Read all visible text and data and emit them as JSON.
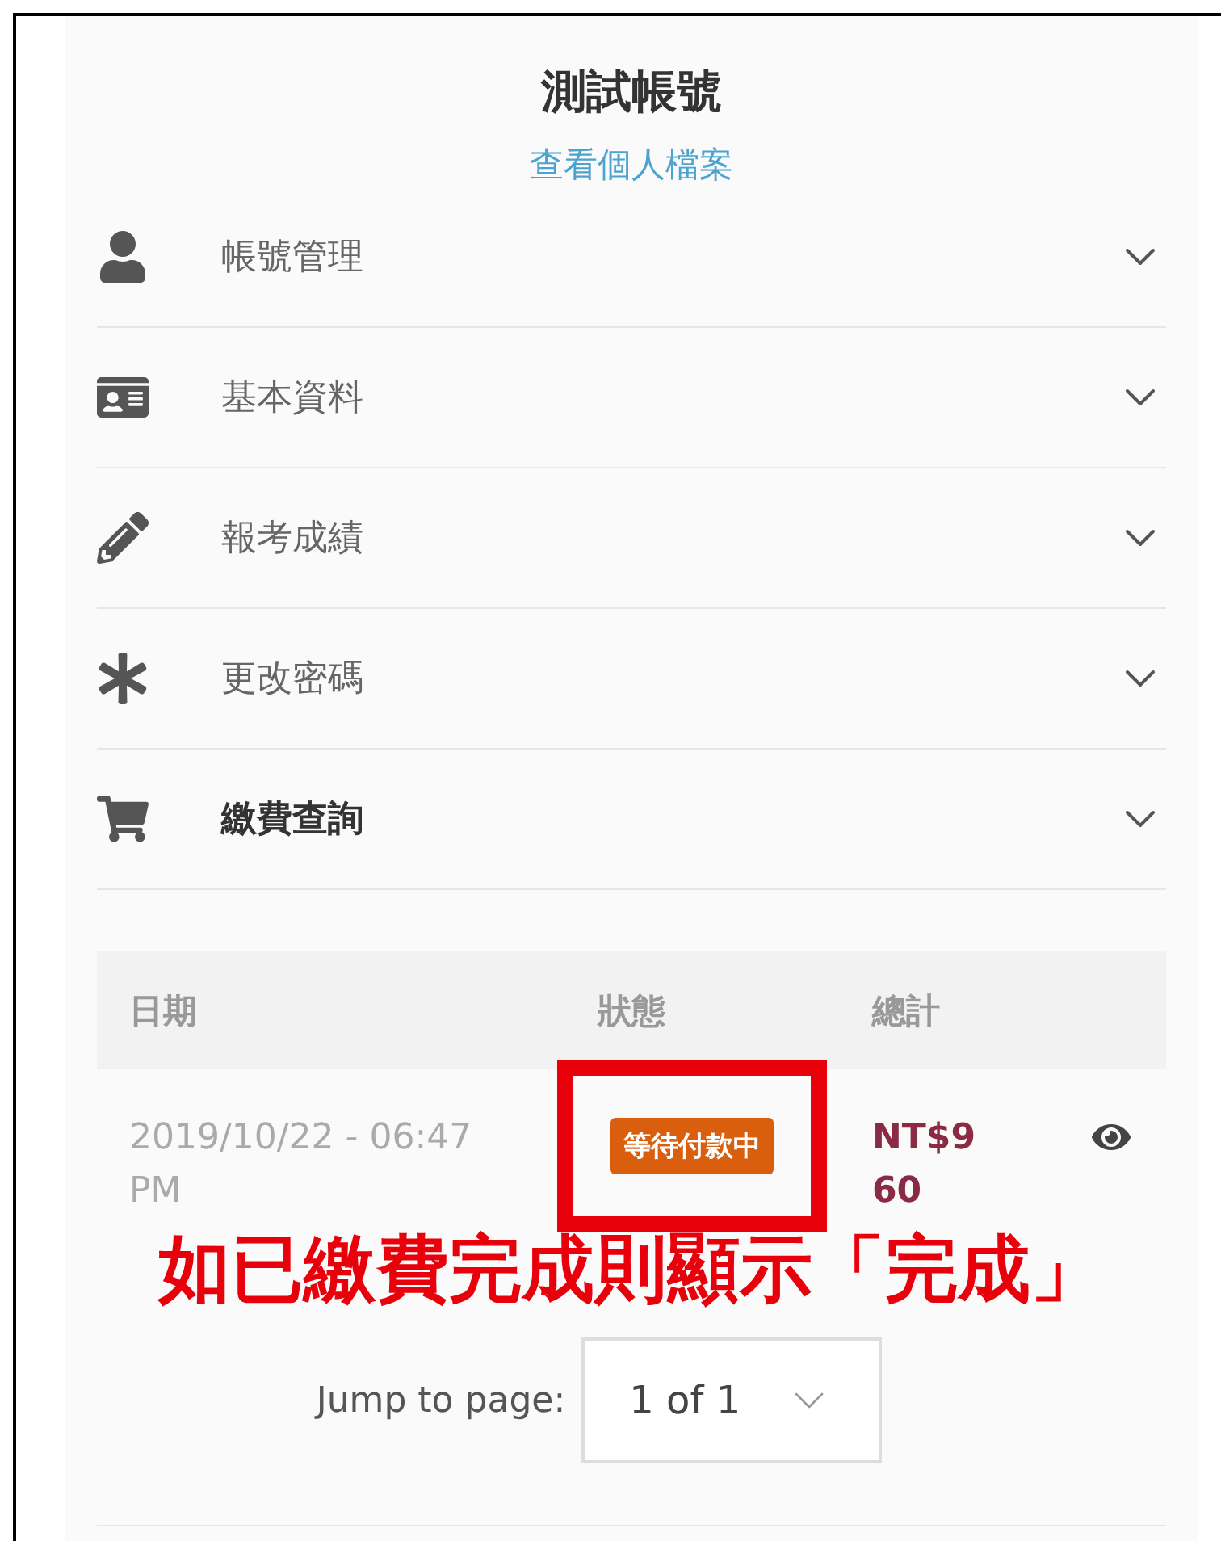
{
  "header": {
    "title": "測試帳號",
    "profile_link": "查看個人檔案"
  },
  "menu": [
    {
      "kind": "user",
      "label": "帳號管理",
      "expanded": false
    },
    {
      "kind": "card",
      "label": "基本資料",
      "expanded": false
    },
    {
      "kind": "pencil",
      "label": "報考成績",
      "expanded": false
    },
    {
      "kind": "asterisk",
      "label": "更改密碼",
      "expanded": false
    },
    {
      "kind": "cart",
      "label": "繳費查詢",
      "expanded": true
    }
  ],
  "orders": {
    "columns": [
      "日期",
      "狀態",
      "總計"
    ],
    "rows": [
      {
        "date": "2019/10/22 - 06:47 PM",
        "status": "等待付款中",
        "total": "NT$960"
      }
    ]
  },
  "annotation": {
    "text": "如已繳費完成則顯示「完成」"
  },
  "pagination": {
    "label": "Jump to page:",
    "value": "1 of 1"
  }
}
